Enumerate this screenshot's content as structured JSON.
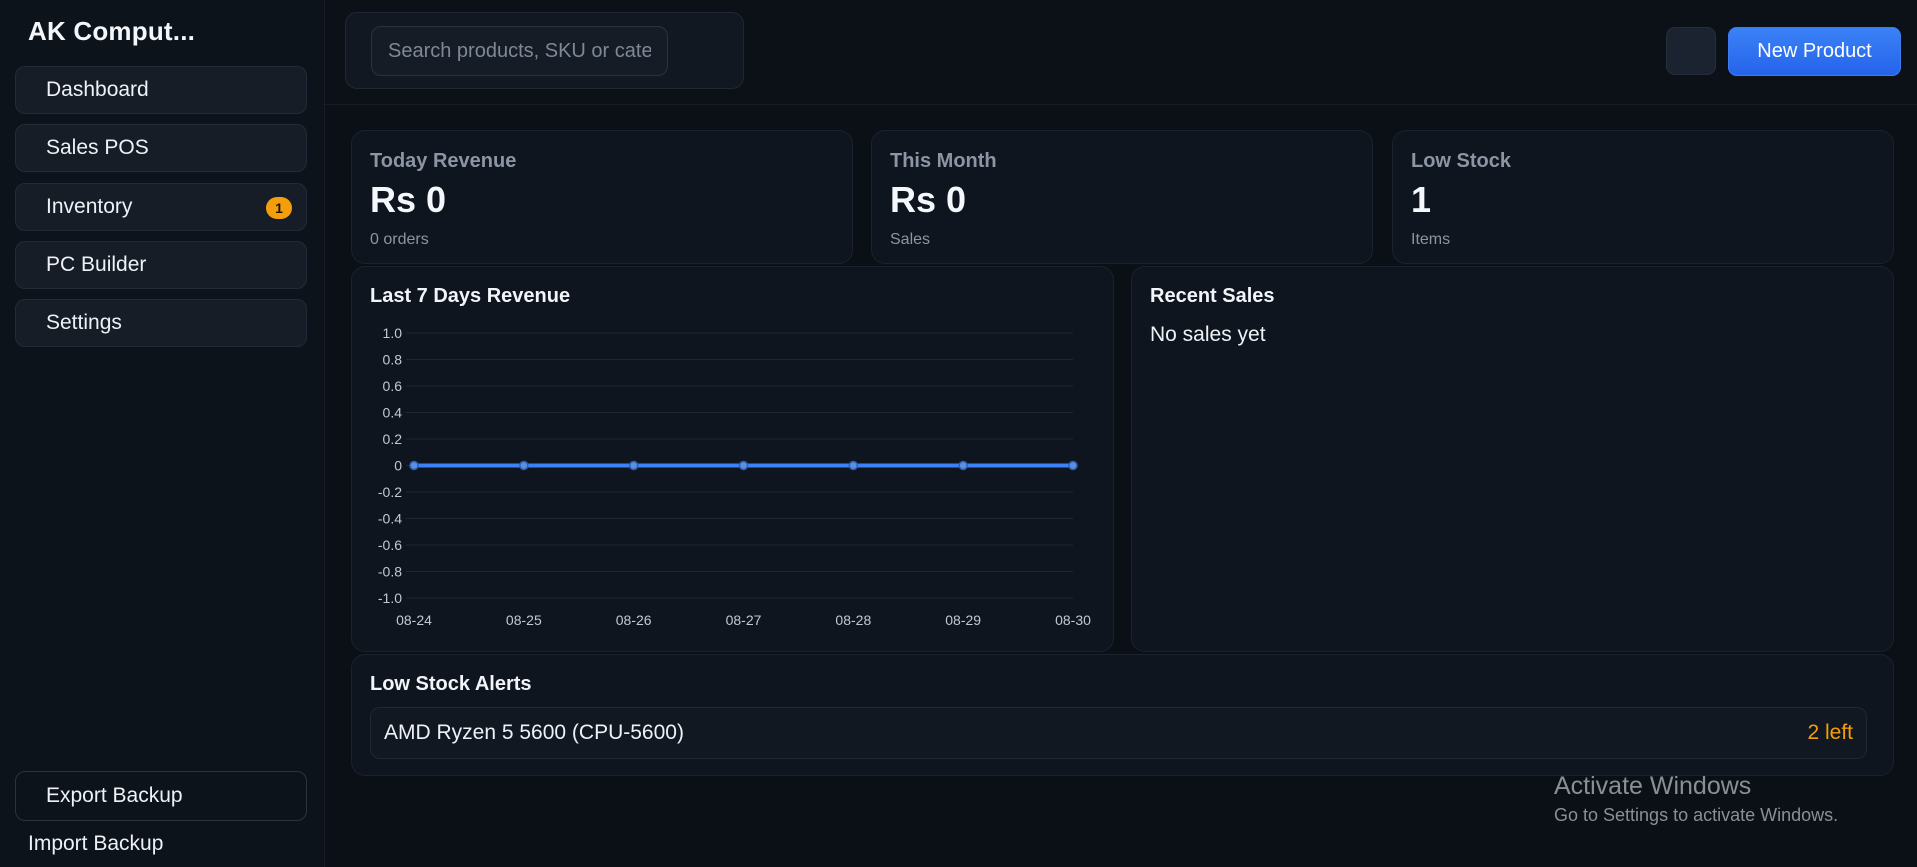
{
  "app": {
    "brand": "AK Comput..."
  },
  "sidebar": {
    "items": [
      {
        "label": "Dashboard"
      },
      {
        "label": "Sales POS"
      },
      {
        "label": "Inventory",
        "badge": "1"
      },
      {
        "label": "PC Builder"
      },
      {
        "label": "Settings"
      }
    ],
    "export_label": "Export Backup",
    "import_label": "Import Backup"
  },
  "topbar": {
    "search_placeholder": "Search products, SKU or category",
    "new_product_label": "New Product"
  },
  "stats": [
    {
      "label": "Today Revenue",
      "value": "Rs 0",
      "sub": "0 orders"
    },
    {
      "label": "This Month",
      "value": "Rs 0",
      "sub": "Sales"
    },
    {
      "label": "Low Stock",
      "value": "1",
      "sub": "Items"
    }
  ],
  "revenue_card": {
    "title": "Last 7 Days Revenue"
  },
  "recent_sales": {
    "title": "Recent Sales",
    "empty": "No sales yet"
  },
  "low_stock": {
    "title": "Low Stock Alerts",
    "items": [
      {
        "name": "AMD Ryzen 5 5600 (CPU-5600)",
        "qty": "2 left"
      }
    ]
  },
  "watermark": {
    "title": "Activate Windows",
    "subtitle": "Go to Settings to activate Windows."
  },
  "colors": {
    "accent": "#3b82f6",
    "warning": "#f59e0b"
  },
  "chart_data": {
    "type": "line",
    "categories": [
      "08-24",
      "08-25",
      "08-26",
      "08-27",
      "08-28",
      "08-29",
      "08-30"
    ],
    "series": [
      {
        "values": [
          0,
          0,
          0,
          0,
          0,
          0,
          0
        ]
      }
    ],
    "ylim": [
      -1.0,
      1.0
    ],
    "yticks": [
      1.0,
      0.8,
      0.6,
      0.4,
      0.2,
      0,
      -0.2,
      -0.4,
      -0.6,
      -0.8,
      -1.0
    ],
    "yticklabels": [
      "1.0",
      "0.8",
      "0.6",
      "0.4",
      "0.2",
      "0",
      "-0.2",
      "-0.4",
      "-0.6",
      "-0.8",
      "-1.0"
    ],
    "grid": true,
    "color": "#3b82f6"
  }
}
